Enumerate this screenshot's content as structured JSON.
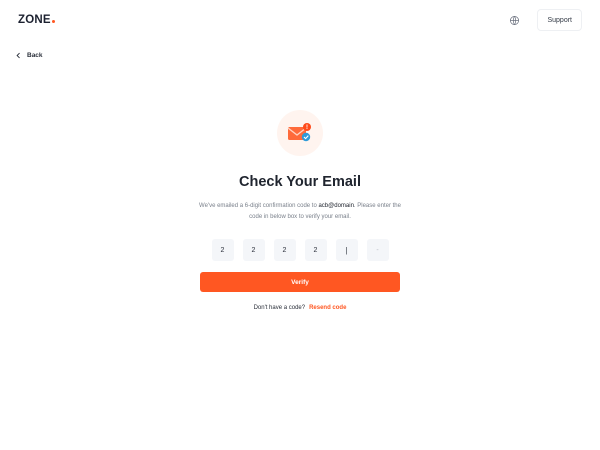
{
  "header": {
    "logo_text": "ZONE",
    "support_label": "Support",
    "icons": {
      "language": "globe-icon"
    }
  },
  "nav": {
    "back_label": "Back",
    "back_icon": "chevron-left-icon"
  },
  "main": {
    "icon": "envelope-notification-icon",
    "title": "Check Your Email",
    "desc_prefix": "We've emailed a 6-digit confirmation code to ",
    "email": "acb@domain",
    "desc_suffix": ". Please enter the code in below box to verify your email.",
    "code": [
      "2",
      "2",
      "2",
      "2",
      "|",
      "-"
    ],
    "verify_label": "Verify",
    "resend_prompt": "Don't have a code?",
    "resend_link": "Resend code"
  },
  "colors": {
    "accent": "#ff5722",
    "text_dark": "#20252f",
    "muted": "#7a808b",
    "code_bg": "#f4f6f9"
  }
}
